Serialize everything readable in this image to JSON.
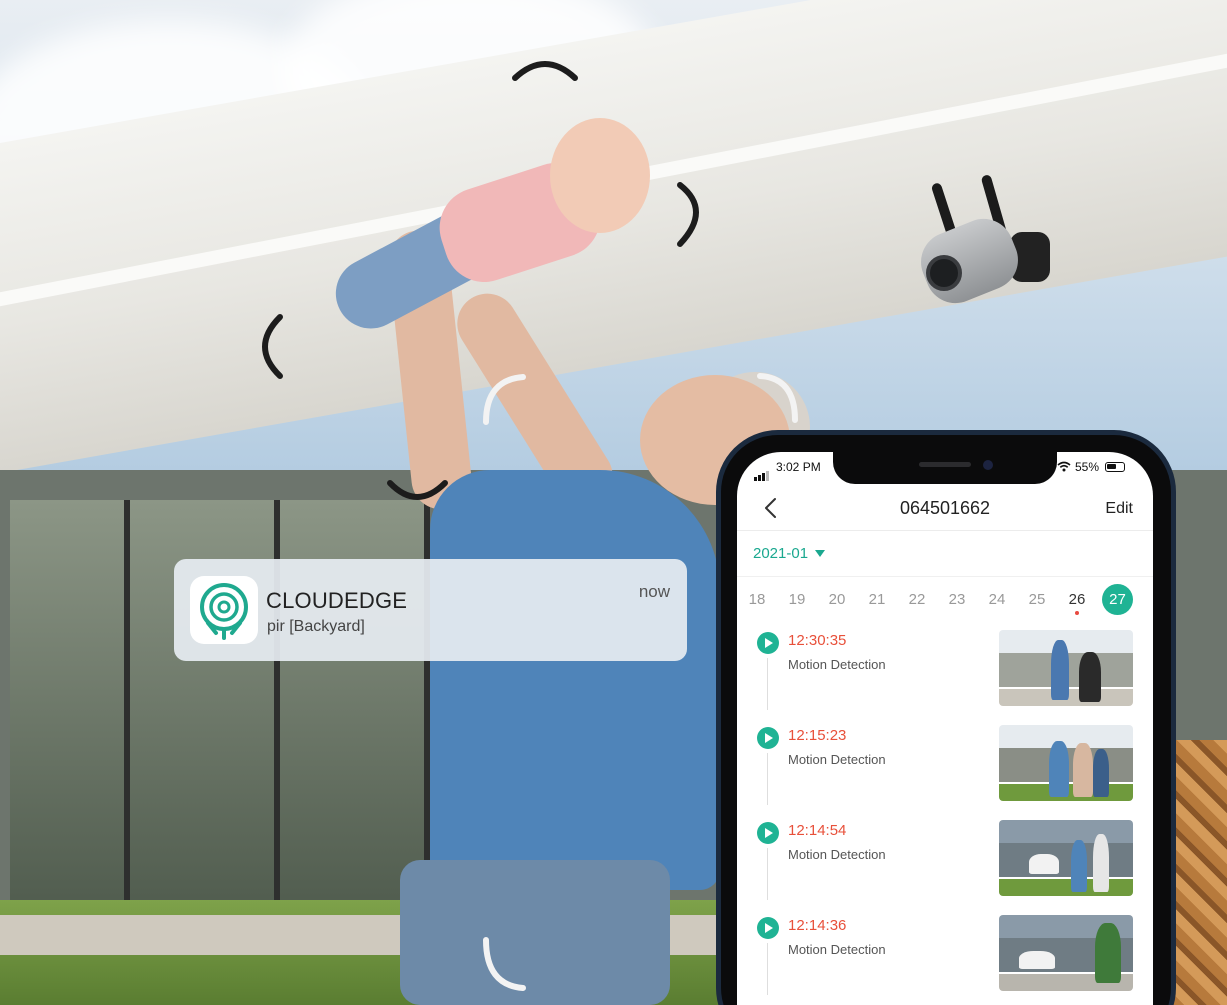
{
  "notification": {
    "app_icon": "cloudedge-logo-icon",
    "app_name": "CLOUDEDGE",
    "message": "pir [Backyard]",
    "time": "now"
  },
  "phone": {
    "status_bar": {
      "time": "3:02 PM",
      "battery": "55%"
    },
    "nav": {
      "back_icon": "chevron-left-icon",
      "title": "064501662",
      "edit_label": "Edit"
    },
    "month_selector": {
      "value": "2021-01",
      "icon": "caret-down-icon"
    },
    "days": [
      "18",
      "19",
      "20",
      "21",
      "22",
      "23",
      "24",
      "25",
      "26",
      "27"
    ],
    "days_with_events_marker": [
      "26"
    ],
    "selected_day": "27",
    "events": [
      {
        "time": "12:30:35",
        "label": "Motion Detection"
      },
      {
        "time": "12:15:23",
        "label": "Motion Detection"
      },
      {
        "time": "12:14:54",
        "label": "Motion Detection"
      },
      {
        "time": "12:14:36",
        "label": "Motion Detection"
      }
    ]
  },
  "colors": {
    "accent": "#1fb394",
    "event_time": "#e8503a",
    "notification_bg": "#e6ecf1"
  }
}
